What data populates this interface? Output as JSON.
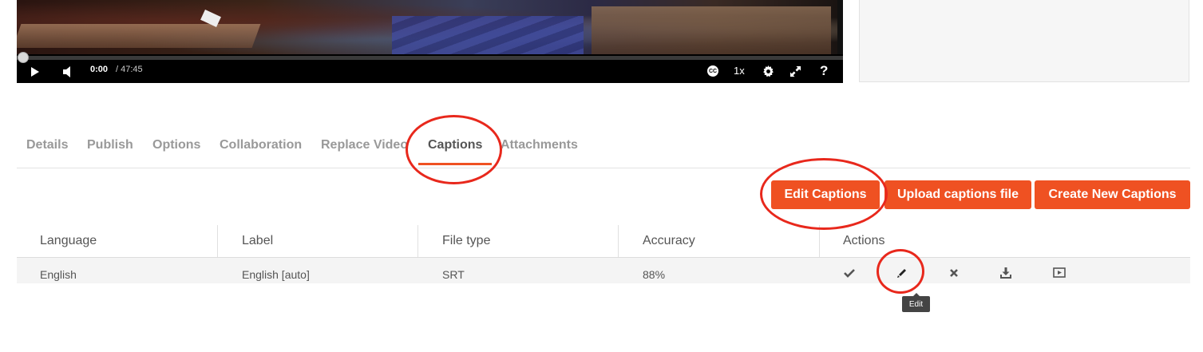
{
  "player": {
    "current_time": "0:00",
    "duration": "/ 47:45",
    "cc_label": "CC",
    "speed": "1x",
    "help": "?",
    "progress_fraction": 0.0
  },
  "tabs": [
    {
      "label": "Details",
      "active": false
    },
    {
      "label": "Publish",
      "active": false
    },
    {
      "label": "Options",
      "active": false
    },
    {
      "label": "Collaboration",
      "active": false
    },
    {
      "label": "Replace Video",
      "active": false
    },
    {
      "label": "Captions",
      "active": true
    },
    {
      "label": "Attachments",
      "active": false
    }
  ],
  "buttons": {
    "edit_captions": "Edit Captions",
    "upload_captions": "Upload captions file",
    "create_captions": "Create New Captions"
  },
  "table": {
    "headers": [
      "Language",
      "Label",
      "File type",
      "Accuracy",
      "Actions"
    ],
    "rows": [
      {
        "language": "English",
        "label": "English [auto]",
        "file_type": "SRT",
        "accuracy": "88%"
      }
    ]
  },
  "tooltip": "Edit",
  "colors": {
    "accent": "#ef5122",
    "annotation": "#e8281c"
  }
}
